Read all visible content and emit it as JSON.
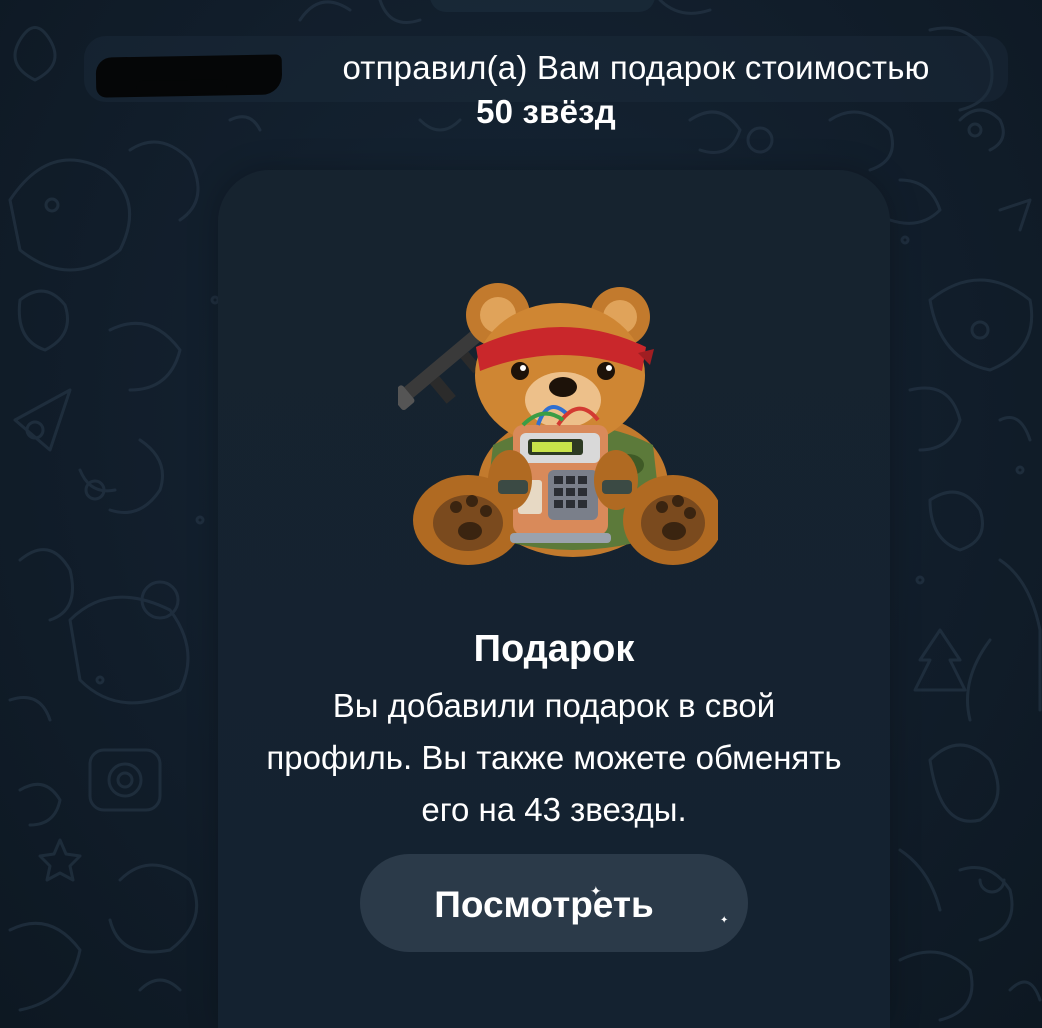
{
  "service_message": {
    "text": "отправил(а) Вам подарок стоимостью",
    "amount": "50 звёзд"
  },
  "gift": {
    "title": "Подарок",
    "description": "Вы добавили подарок в свой профиль. Вы также можете обменять его на 43 звезды.",
    "button_label": "Посмотреть",
    "sticker": "teddy-bear-commando-sticker"
  },
  "colors": {
    "background": "#111d2a",
    "card": "#152230",
    "button": "#2b3a49",
    "text": "#ffffff"
  }
}
